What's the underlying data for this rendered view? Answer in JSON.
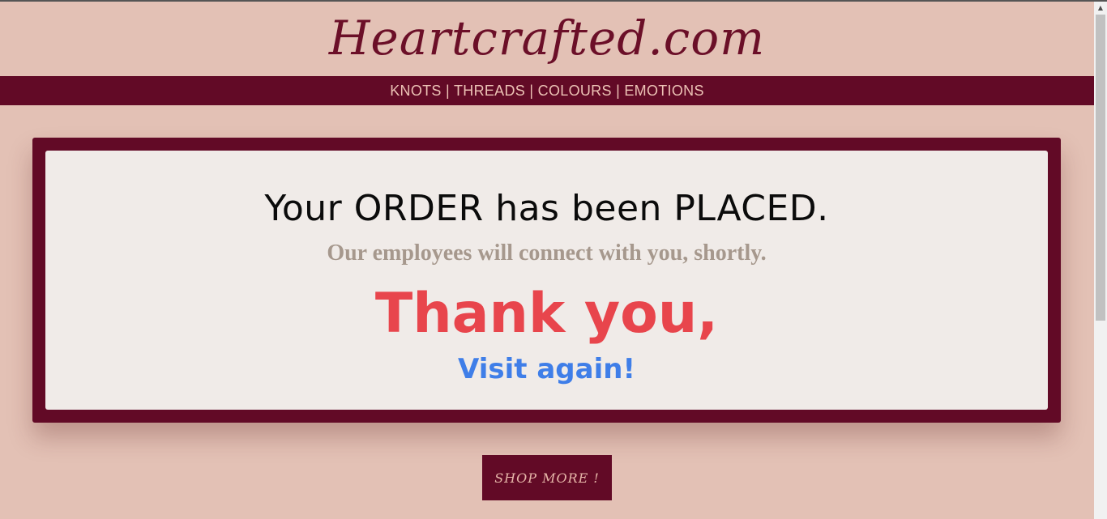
{
  "brand": "Heartcrafted.com",
  "nav": {
    "text": "KNOTS | THREADS | COLOURS | EMOTIONS"
  },
  "confirmation": {
    "headline": "Your ORDER has been PLACED.",
    "subline": "Our employees will connect with you, shortly.",
    "thanks": "Thank you,",
    "visit": "Visit again!"
  },
  "cta": {
    "label": "SHOP MORE !"
  },
  "scrollbar": {
    "up_arrow": "▲"
  },
  "colors": {
    "background": "#e3c1b5",
    "brand": "#620a26",
    "thanks": "#e8454c",
    "visit": "#3f7ee8"
  }
}
